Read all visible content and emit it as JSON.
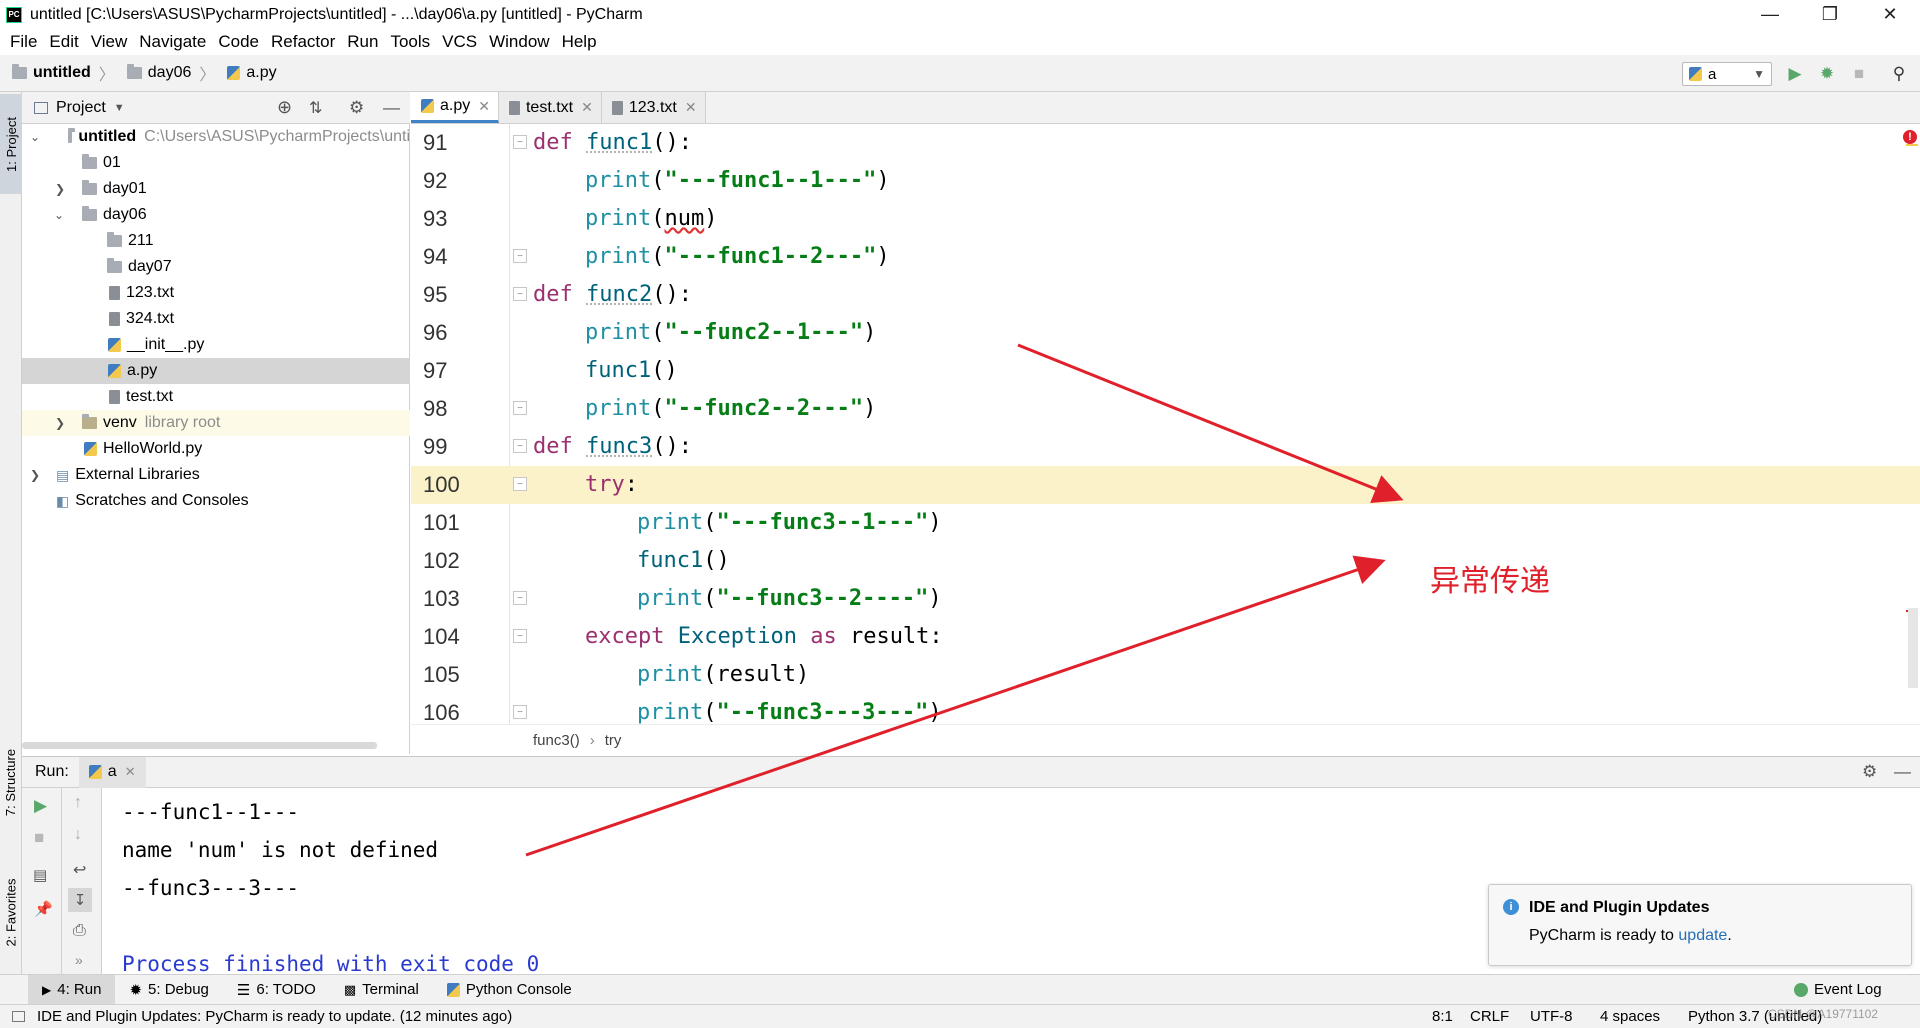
{
  "window": {
    "title": "untitled [C:\\Users\\ASUS\\PycharmProjects\\untitled] - ...\\day06\\a.py [untitled] - PyCharm",
    "app_icon": "PC"
  },
  "menu": [
    "File",
    "Edit",
    "View",
    "Navigate",
    "Code",
    "Refactor",
    "Run",
    "Tools",
    "VCS",
    "Window",
    "Help"
  ],
  "breadcrumb": [
    "untitled",
    "day06",
    "a.py"
  ],
  "run_config": "a",
  "sidebar_tabs": {
    "project": "1: Project",
    "structure": "7: Structure",
    "favorites": "2: Favorites"
  },
  "project_panel": {
    "title": "Project",
    "tree": [
      {
        "name": "untitled",
        "extra": "C:\\Users\\ASUS\\PycharmProjects\\unti",
        "type": "folder",
        "arrow": "open",
        "bold": true
      },
      {
        "name": "01",
        "type": "folder"
      },
      {
        "name": "day01",
        "type": "folder",
        "arrow": "closed"
      },
      {
        "name": "day06",
        "type": "folder",
        "arrow": "open"
      },
      {
        "name": "211",
        "type": "folder"
      },
      {
        "name": "day07",
        "type": "folder"
      },
      {
        "name": "123.txt",
        "type": "txt"
      },
      {
        "name": "324.txt",
        "type": "txt"
      },
      {
        "name": "__init__.py",
        "type": "py"
      },
      {
        "name": "a.py",
        "type": "py",
        "selected": true
      },
      {
        "name": "test.txt",
        "type": "txt"
      },
      {
        "name": "venv",
        "extra": "library root",
        "type": "folder",
        "arrow": "closed"
      },
      {
        "name": "HelloWorld.py",
        "type": "py"
      },
      {
        "name": "External Libraries",
        "type": "lib",
        "arrow": "closed"
      },
      {
        "name": "Scratches and Consoles",
        "type": "scratch"
      }
    ]
  },
  "editor_tabs": [
    "a.py",
    "test.txt",
    "123.txt"
  ],
  "code_lines": [
    {
      "n": "91"
    },
    {
      "n": "92"
    },
    {
      "n": "93"
    },
    {
      "n": "94"
    },
    {
      "n": "95"
    },
    {
      "n": "96"
    },
    {
      "n": "97"
    },
    {
      "n": "98"
    },
    {
      "n": "99"
    },
    {
      "n": "100"
    },
    {
      "n": "101"
    },
    {
      "n": "102"
    },
    {
      "n": "103"
    },
    {
      "n": "104"
    },
    {
      "n": "105"
    },
    {
      "n": "106"
    }
  ],
  "code_breadcrumb": [
    "func3()",
    "try"
  ],
  "run_panel": {
    "label": "Run:",
    "tab": "a",
    "output": [
      "---func1--1---",
      "name 'num' is not defined",
      "--func3---3---",
      "",
      "Process finished with exit code 0"
    ]
  },
  "bottom_tools": [
    "4: Run",
    "5: Debug",
    "6: TODO",
    "Terminal",
    "Python Console",
    "Event Log"
  ],
  "notification": {
    "title": "IDE and Plugin Updates",
    "text": "PyCharm is ready to",
    "link": "update",
    "end": "."
  },
  "status": {
    "message": "IDE and Plugin Updates: PyCharm is ready to update. (12 minutes ago)",
    "position": "8:1",
    "line_sep": "CRLF",
    "encoding": "UTF-8",
    "indent": "4 spaces",
    "interpreter": "Python 3.7 (untitled)",
    "watermark": "CSDN @A19771102"
  },
  "annotation": "异常传递",
  "colors": {
    "accent": "#4083c9",
    "arrow": "#e0202a",
    "highlight_line": "#fbf2c9"
  }
}
